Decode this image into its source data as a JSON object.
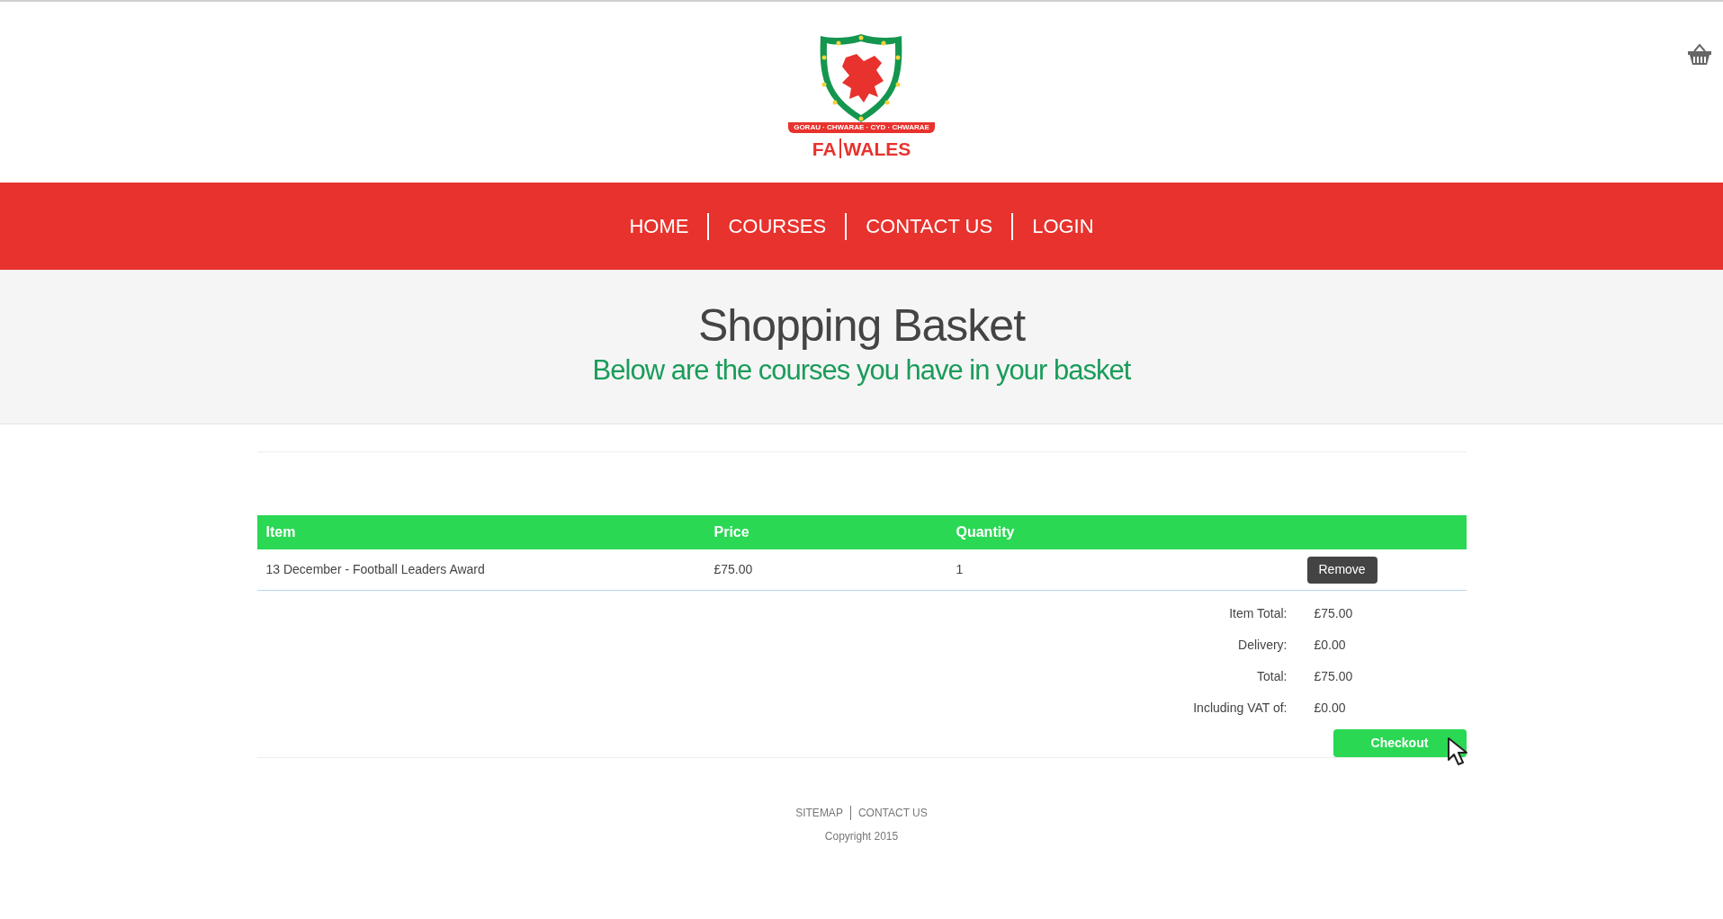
{
  "header": {
    "logo": {
      "motto": "GORAU · CHWARAE · CYD · CHWARAE",
      "wordmark_left": "FA",
      "wordmark_right": "WALES"
    }
  },
  "nav": {
    "items": [
      {
        "label": "HOME"
      },
      {
        "label": "COURSES"
      },
      {
        "label": "CONTACT US"
      },
      {
        "label": "LOGIN"
      }
    ]
  },
  "hero": {
    "title": "Shopping Basket",
    "subtitle": "Below are the courses you have in your basket"
  },
  "basket": {
    "columns": [
      "Item",
      "Price",
      "Quantity"
    ],
    "rows": [
      {
        "item": "13 December - Football Leaders Award",
        "price": "£75.00",
        "quantity": "1",
        "action": "Remove"
      }
    ],
    "totals": [
      {
        "label": "Item Total:",
        "value": "£75.00"
      },
      {
        "label": "Delivery:",
        "value": "£0.00"
      },
      {
        "label": "Total:",
        "value": "£75.00"
      },
      {
        "label": "Including VAT of:",
        "value": "£0.00"
      }
    ],
    "checkout": "Checkout"
  },
  "footer": {
    "links": [
      "SITEMAP",
      "CONTACT US"
    ],
    "copyright": "Copyright 2015"
  }
}
